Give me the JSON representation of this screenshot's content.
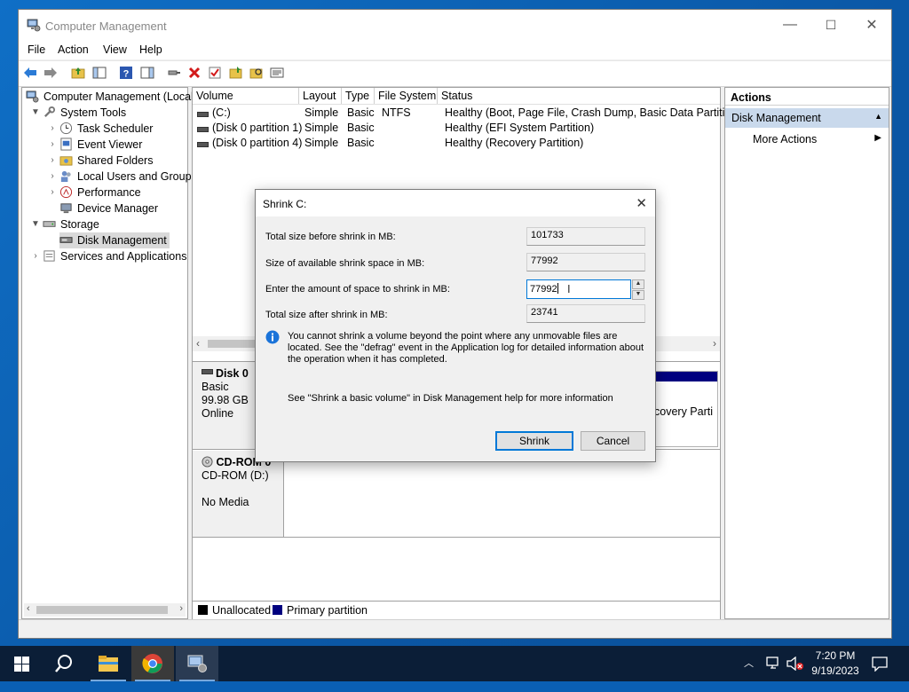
{
  "window": {
    "title": "Computer Management",
    "min_glyph": "—",
    "max_glyph": "☐",
    "close_glyph": "✕"
  },
  "menu": [
    "File",
    "Action",
    "View",
    "Help"
  ],
  "tree": {
    "root": "Computer Management (Local",
    "system_tools": "System Tools",
    "items": [
      "Task Scheduler",
      "Event Viewer",
      "Shared Folders",
      "Local Users and Groups",
      "Performance",
      "Device Manager"
    ],
    "storage": "Storage",
    "disk_management": "Disk Management",
    "services": "Services and Applications"
  },
  "volumes": {
    "headers": [
      "Volume",
      "Layout",
      "Type",
      "File System",
      "Status"
    ],
    "rows": [
      {
        "volume": "(C:)",
        "layout": "Simple",
        "type": "Basic",
        "fs": "NTFS",
        "status": "Healthy (Boot, Page File, Crash Dump, Basic Data Partition)"
      },
      {
        "volume": "(Disk 0 partition 1)",
        "layout": "Simple",
        "type": "Basic",
        "fs": "",
        "status": "Healthy (EFI System Partition)"
      },
      {
        "volume": "(Disk 0 partition 4)",
        "layout": "Simple",
        "type": "Basic",
        "fs": "",
        "status": "Healthy (Recovery Partition)"
      }
    ]
  },
  "disks": {
    "disk0": {
      "name": "Disk 0",
      "type": "Basic",
      "size": "99.98 GB",
      "state": "Online",
      "partition_peek": "covery Parti"
    },
    "cdrom": {
      "name": "CD-ROM 0",
      "drive": "CD-ROM (D:)",
      "media": "No Media"
    }
  },
  "legend": {
    "unallocated": "Unallocated",
    "primary": "Primary partition",
    "unallocated_color": "#000000",
    "primary_color": "#00007f"
  },
  "actions": {
    "header": "Actions",
    "section": "Disk Management",
    "more": "More Actions"
  },
  "dialog": {
    "title": "Shrink C:",
    "labels": {
      "total_before": "Total size before shrink in MB:",
      "available": "Size of available shrink space in MB:",
      "enter_amount": "Enter the amount of space to shrink in MB:",
      "total_after": "Total size after shrink in MB:"
    },
    "values": {
      "total_before": "101733",
      "available": "77992",
      "enter_amount": "77992",
      "total_after": "23741"
    },
    "info_text": "You cannot shrink a volume beyond the point where any unmovable files are located. See the \"defrag\" event in the Application log for detailed information about the operation when it has completed.",
    "help_text": "See \"Shrink a basic volume\" in Disk Management help for more information",
    "shrink_button": "Shrink",
    "cancel_button": "Cancel"
  },
  "taskbar": {
    "time": "7:20 PM",
    "date": "9/19/2023"
  }
}
